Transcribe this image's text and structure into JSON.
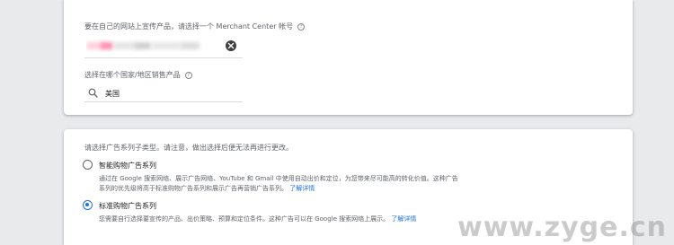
{
  "merchant": {
    "label": "要在自己的网站上宣传产品，请选择一个 Merchant Center 帐号",
    "help_icon": "help-circle-icon",
    "clear_icon": "clear-icon"
  },
  "country": {
    "label": "选择在哪个国家/地区销售产品",
    "help_icon": "help-circle-icon",
    "search_icon": "search-icon",
    "value": "美国"
  },
  "subtype": {
    "hint": "请选择广告系列子类型。请注意，做出选择后便无法再进行更改。",
    "options": [
      {
        "title": "智能购物广告系列",
        "checked": false,
        "desc_line1": "通过在 Google 搜索网络、展示广告网络、YouTube 和 Gmail 中使用自动出价和定位，为您带来尽可能高的转化价值。这种广告",
        "desc_line2": "系列的优先级将高于标准购物广告系列和展示广告再营销广告系列。",
        "link": "了解详情"
      },
      {
        "title": "标准购物广告系列",
        "checked": true,
        "desc_line1": "您需要自行选择要宣传的产品、出价策略、预算和定位条件。这种广告可以在 Google 搜索网络上展示。",
        "link": "了解详情"
      }
    ]
  },
  "watermark": "www.zyge.cn",
  "colors": {
    "accent": "#1a73e8",
    "background": "#e9eaec"
  }
}
